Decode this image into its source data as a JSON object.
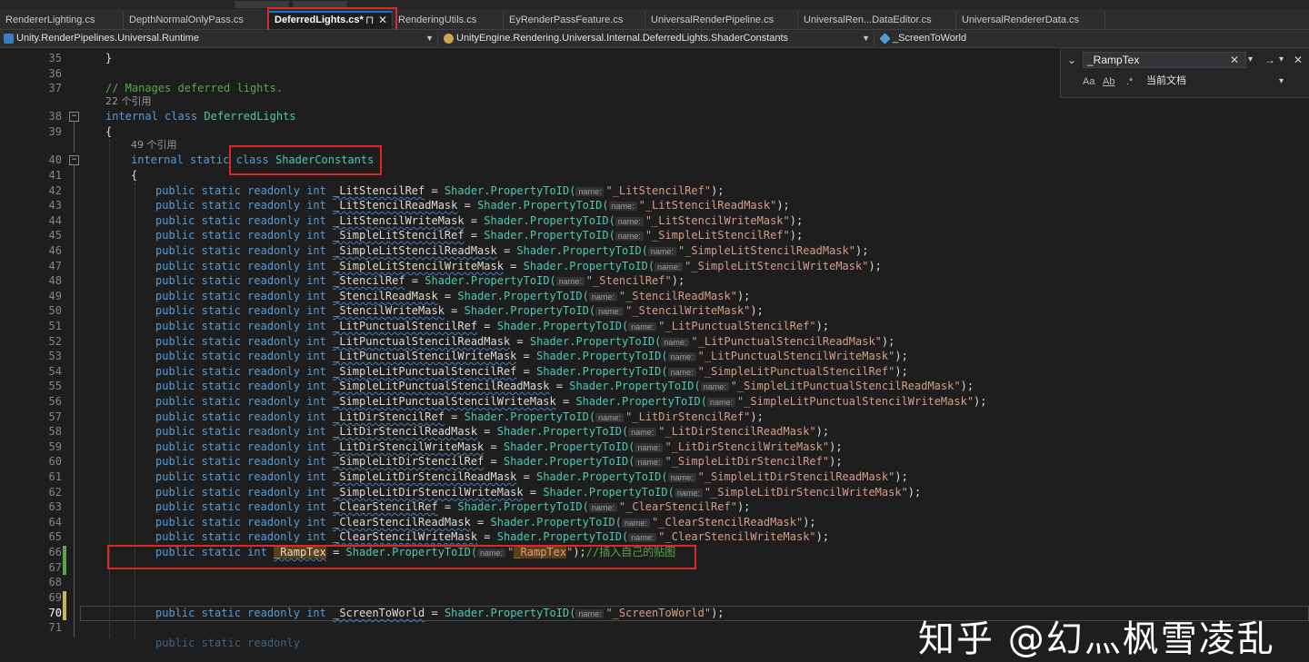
{
  "tabs": [
    {
      "label": "RendererLighting.cs"
    },
    {
      "label": "DepthNormalOnlyPass.cs"
    },
    {
      "label": "DeferredLights.cs*"
    },
    {
      "label": "RenderingUtils.cs"
    },
    {
      "label": "EyRenderPassFeature.cs"
    },
    {
      "label": "UniversalRenderPipeline.cs"
    },
    {
      "label": "UniversalRen...DataEditor.cs"
    },
    {
      "label": "UniversalRendererData.cs"
    }
  ],
  "tab_icons": {
    "pin": "⊓",
    "close": "✕"
  },
  "navbar": {
    "project": "Unity.RenderPipelines.Universal.Runtime",
    "type": "UnityEngine.Rendering.Universal.Internal.DeferredLights.ShaderConstants",
    "member": "_ScreenToWorld",
    "dropdown_glyph": "▼"
  },
  "find": {
    "query": "_RampTex",
    "scope": "当前文档",
    "collapse_glyph": "⌄",
    "clear_glyph": "✕",
    "dropdown_glyph": "▾",
    "next_glyph": "→",
    "close_glyph": "✕",
    "match_case": "Aa",
    "whole_word": "Ab",
    "regex": ".*"
  },
  "editor": {
    "line_numbers": [
      "35",
      "36",
      "37",
      "38",
      "39",
      "40",
      "41",
      "42",
      "43",
      "44",
      "45",
      "46",
      "47",
      "48",
      "49",
      "50",
      "51",
      "52",
      "53",
      "54",
      "55",
      "56",
      "57",
      "58",
      "59",
      "60",
      "61",
      "62",
      "63",
      "64",
      "65",
      "66",
      "67",
      "68",
      "69",
      "70",
      "71"
    ],
    "current_line": "70",
    "param_hint": "name:",
    "brace_close": "}",
    "brace_open": "{",
    "comment_line": "// Manages deferred lights.",
    "refs_class": "22 个引用",
    "refs_inner": "49 个引用",
    "class_decl": {
      "modifiers": "internal class",
      "name": "DeferredLights"
    },
    "inner_decl": {
      "modifiers": "internal static",
      "class_kw": "class",
      "name": "ShaderConstants"
    },
    "decl_prefix": "public static readonly",
    "type_int": "int",
    "shader_call": "Shader.PropertyToID(",
    "constants": [
      {
        "name": "_LitStencilRef",
        "str": "\"_LitStencilRef\""
      },
      {
        "name": "_LitStencilReadMask",
        "str": "\"_LitStencilReadMask\""
      },
      {
        "name": "_LitStencilWriteMask",
        "str": "\"_LitStencilWriteMask\""
      },
      {
        "name": "_SimpleLitStencilRef",
        "str": "\"_SimpleLitStencilRef\""
      },
      {
        "name": "_SimpleLitStencilReadMask",
        "str": "\"_SimpleLitStencilReadMask\""
      },
      {
        "name": "_SimpleLitStencilWriteMask",
        "str": "\"_SimpleLitStencilWriteMask\""
      },
      {
        "name": "_StencilRef",
        "str": "\"_StencilRef\""
      },
      {
        "name": "_StencilReadMask",
        "str": "\"_StencilReadMask\""
      },
      {
        "name": "_StencilWriteMask",
        "str": "\"_StencilWriteMask\""
      },
      {
        "name": "_LitPunctualStencilRef",
        "str": "\"_LitPunctualStencilRef\""
      },
      {
        "name": "_LitPunctualStencilReadMask",
        "str": "\"_LitPunctualStencilReadMask\""
      },
      {
        "name": "_LitPunctualStencilWriteMask",
        "str": "\"_LitPunctualStencilWriteMask\""
      },
      {
        "name": "_SimpleLitPunctualStencilRef",
        "str": "\"_SimpleLitPunctualStencilRef\""
      },
      {
        "name": "_SimpleLitPunctualStencilReadMask",
        "str": "\"_SimpleLitPunctualStencilReadMask\""
      },
      {
        "name": "_SimpleLitPunctualStencilWriteMask",
        "str": "\"_SimpleLitPunctualStencilWriteMask\""
      },
      {
        "name": "_LitDirStencilRef",
        "str": "\"_LitDirStencilRef\""
      },
      {
        "name": "_LitDirStencilReadMask",
        "str": "\"_LitDirStencilReadMask\""
      },
      {
        "name": "_LitDirStencilWriteMask",
        "str": "\"_LitDirStencilWriteMask\""
      },
      {
        "name": "_SimpleLitDirStencilRef",
        "str": "\"_SimpleLitDirStencilRef\""
      },
      {
        "name": "_SimpleLitDirStencilReadMask",
        "str": "\"_SimpleLitDirStencilReadMask\""
      },
      {
        "name": "_SimpleLitDirStencilWriteMask",
        "str": "\"_SimpleLitDirStencilWriteMask\""
      },
      {
        "name": "_ClearStencilRef",
        "str": "\"_ClearStencilRef\""
      },
      {
        "name": "_ClearStencilReadMask",
        "str": "\"_ClearStencilReadMask\""
      },
      {
        "name": "_ClearStencilWriteMask",
        "str": "\"_ClearStencilWriteMask\""
      }
    ],
    "ramp_line": {
      "prefix": "public static int",
      "name": "_RampTex",
      "str": "_RampTex",
      "comment": "//插入自己的贴图"
    },
    "screen_line": {
      "name": "_ScreenToWorld",
      "str": "\"_ScreenToWorld\""
    }
  },
  "watermark": "知乎 @幻灬枫雪凌乱",
  "colors": {
    "annotation_box": "#e22525",
    "keyword": "#569cd6",
    "type": "#4ec9b0",
    "comment": "#57a64a",
    "string": "#d69d85"
  }
}
